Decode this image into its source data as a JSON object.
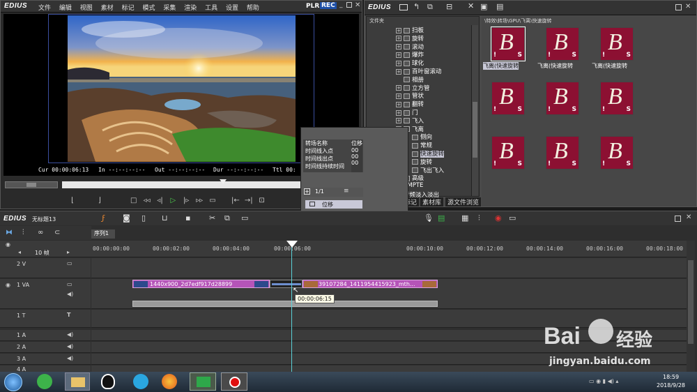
{
  "player": {
    "logo": "EDIUS",
    "menu": [
      "文件",
      "编辑",
      "视图",
      "素材",
      "标记",
      "模式",
      "采集",
      "渲染",
      "工具",
      "设置",
      "帮助"
    ],
    "plr": "PLR",
    "rec": "REC",
    "cur": "Cur 00:00:06:13",
    "in": "In --:--:--:--",
    "out": "Out --:--:--:--",
    "dur": "Dur --:--:--:--",
    "ttl": "Ttl 00:"
  },
  "bin": {
    "logo": "EDIUS",
    "folder_label": "文件夹",
    "path": "\\特效\\转场\\GPU\\飞离\\快速旋转",
    "tree": [
      {
        "label": "扫板",
        "indent": 1,
        "box": "+"
      },
      {
        "label": "旋转",
        "indent": 1,
        "box": "+"
      },
      {
        "label": "滚动",
        "indent": 1,
        "box": "+"
      },
      {
        "label": "爆炸",
        "indent": 1,
        "box": "+"
      },
      {
        "label": "球化",
        "indent": 1,
        "box": "+"
      },
      {
        "label": "百叶窗滚动",
        "indent": 1,
        "box": "+"
      },
      {
        "label": "相册",
        "indent": 1,
        "box": ""
      },
      {
        "label": "立方管",
        "indent": 1,
        "box": "+"
      },
      {
        "label": "管状",
        "indent": 1,
        "box": "+"
      },
      {
        "label": "翻转",
        "indent": 1,
        "box": "+"
      },
      {
        "label": "门",
        "indent": 1,
        "box": "+"
      },
      {
        "label": "飞入",
        "indent": 1,
        "box": "+"
      },
      {
        "label": "飞离",
        "indent": 1,
        "box": "-"
      },
      {
        "label": "侧向",
        "indent": 2,
        "box": ""
      },
      {
        "label": "常规",
        "indent": 2,
        "box": ""
      },
      {
        "label": "快速旋转",
        "indent": 2,
        "box": "",
        "selected": true
      },
      {
        "label": "旋转",
        "indent": 2,
        "box": ""
      },
      {
        "label": "飞出飞入",
        "indent": 2,
        "box": ""
      },
      {
        "label": "高级",
        "indent": 1,
        "box": "+"
      },
      {
        "label": "SMPTE",
        "indent": 0,
        "box": "+"
      },
      {
        "label": "音频淡入淡出",
        "indent": 0,
        "box": ""
      }
    ],
    "thumbs": [
      "飞离(快速旋转",
      "飞离(快速旋转",
      "飞离(快速旋转",
      "",
      "",
      "",
      "",
      "",
      ""
    ],
    "tabs": [
      "特效",
      "序列标记",
      "素材库",
      "源文件浏览"
    ]
  },
  "info": {
    "headers": [
      "转场名称",
      "时间线入点",
      "时间线出点",
      "时间线持续时间"
    ],
    "col2": "位移",
    "page": "1/1",
    "effect": "位移",
    "footer": "信息"
  },
  "timeline": {
    "logo": "EDIUS",
    "project": "无标题13",
    "seq_tab": "序列1",
    "zoom": "10 帧",
    "ruler": [
      "00:00:00:00",
      "00:00:02:00",
      "00:00:04:00",
      "00:00:06:00",
      "00:00:10:00",
      "00:00:12:00",
      "00:00:14:00",
      "00:00:16:00",
      "00:00:18:00"
    ],
    "tracks": [
      "2 V",
      "1 VA",
      "1 T",
      "1 A",
      "2 A",
      "3 A",
      "4 A"
    ],
    "clip1": "1440x900_2d7edf917d28899",
    "clip2": "39107284_1411954415923_mth...",
    "tooltip": "00:00:06:15"
  },
  "taskbar": {
    "time": "18:59",
    "date": "2018/9/28"
  },
  "watermark": {
    "brand": "Bai",
    "cn": "经验",
    "url": "jingyan.baidu.com"
  }
}
